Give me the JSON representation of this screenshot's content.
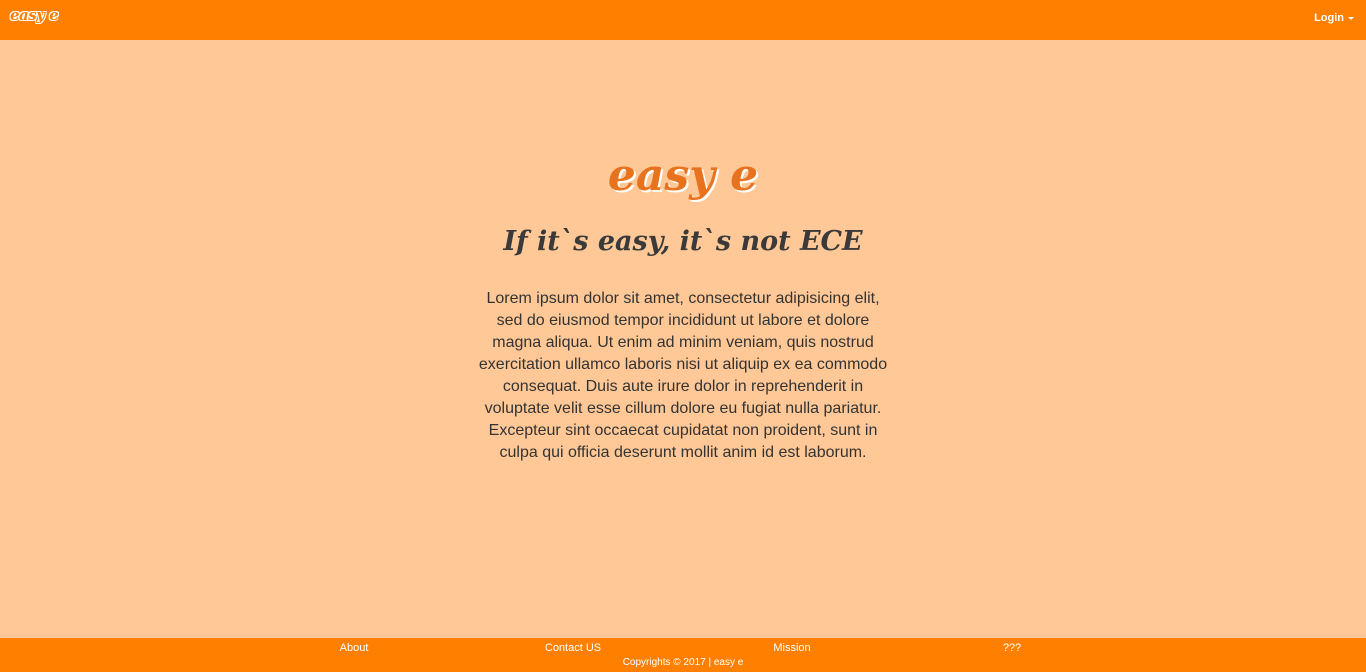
{
  "navbar": {
    "brand": "easy e",
    "login_label": "Login"
  },
  "hero": {
    "title": "easy e",
    "subtitle": "If it`s easy, it`s not ECE",
    "body": "Lorem ipsum dolor sit amet, consectetur adipisicing elit, sed do eiusmod tempor incididunt ut labore et dolore magna aliqua. Ut enim ad minim veniam, quis nostrud exercitation ullamco laboris nisi ut aliquip ex ea commodo consequat. Duis aute irure dolor in reprehenderit in voluptate velit esse cillum dolore eu fugiat nulla pariatur. Excepteur sint occaecat cupidatat non proident, sunt in culpa qui officia deserunt mollit anim id est laborum."
  },
  "footer": {
    "links": [
      {
        "label": "About"
      },
      {
        "label": "Contact US"
      },
      {
        "label": "Mission"
      },
      {
        "label": "???"
      }
    ],
    "copyright": "Copyrights © 2017 | easy e"
  },
  "colors": {
    "bar": "#ff8000",
    "background": "#ffc896",
    "title": "#e8731f",
    "text": "#333333"
  },
  "icons": {
    "login_dropdown": "caret-down-icon"
  }
}
